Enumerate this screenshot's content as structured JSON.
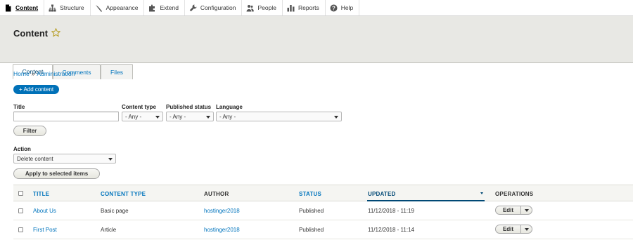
{
  "toolbar": {
    "items": [
      {
        "label": "Content",
        "icon": "document-icon"
      },
      {
        "label": "Structure",
        "icon": "sitemap-icon"
      },
      {
        "label": "Appearance",
        "icon": "brush-icon"
      },
      {
        "label": "Extend",
        "icon": "puzzle-icon"
      },
      {
        "label": "Configuration",
        "icon": "wrench-icon"
      },
      {
        "label": "People",
        "icon": "people-icon"
      },
      {
        "label": "Reports",
        "icon": "bar-chart-icon"
      },
      {
        "label": "Help",
        "icon": "help-icon"
      }
    ]
  },
  "header": {
    "title": "Content",
    "tabs": [
      "Content",
      "Comments",
      "Files"
    ]
  },
  "breadcrumb": {
    "home": "Home",
    "separator": "»",
    "admin": "Administration"
  },
  "add_content": "+ Add content",
  "filters": {
    "title_label": "Title",
    "title_value": "",
    "content_type_label": "Content type",
    "content_type_value": "- Any -",
    "published_status_label": "Published status",
    "published_status_value": "- Any -",
    "language_label": "Language",
    "language_value": "- Any -",
    "filter_button": "Filter"
  },
  "bulk": {
    "action_label": "Action",
    "action_value": "Delete content",
    "apply_button": "Apply to selected items"
  },
  "table": {
    "headers": {
      "title": "TITLE",
      "content_type": "CONTENT TYPE",
      "author": "AUTHOR",
      "status": "STATUS",
      "updated": "UPDATED",
      "operations": "OPERATIONS"
    },
    "rows": [
      {
        "title": "About Us",
        "content_type": "Basic page",
        "author": "hostinger2018",
        "status": "Published",
        "updated": "11/12/2018 - 11:19",
        "operation": "Edit"
      },
      {
        "title": "First Post",
        "content_type": "Article",
        "author": "hostinger2018",
        "status": "Published",
        "updated": "11/12/2018 - 11:14",
        "operation": "Edit"
      }
    ]
  },
  "colors": {
    "link": "#0074bd",
    "primary_button": "#0071b8",
    "header_band": "#e8e8e4"
  }
}
